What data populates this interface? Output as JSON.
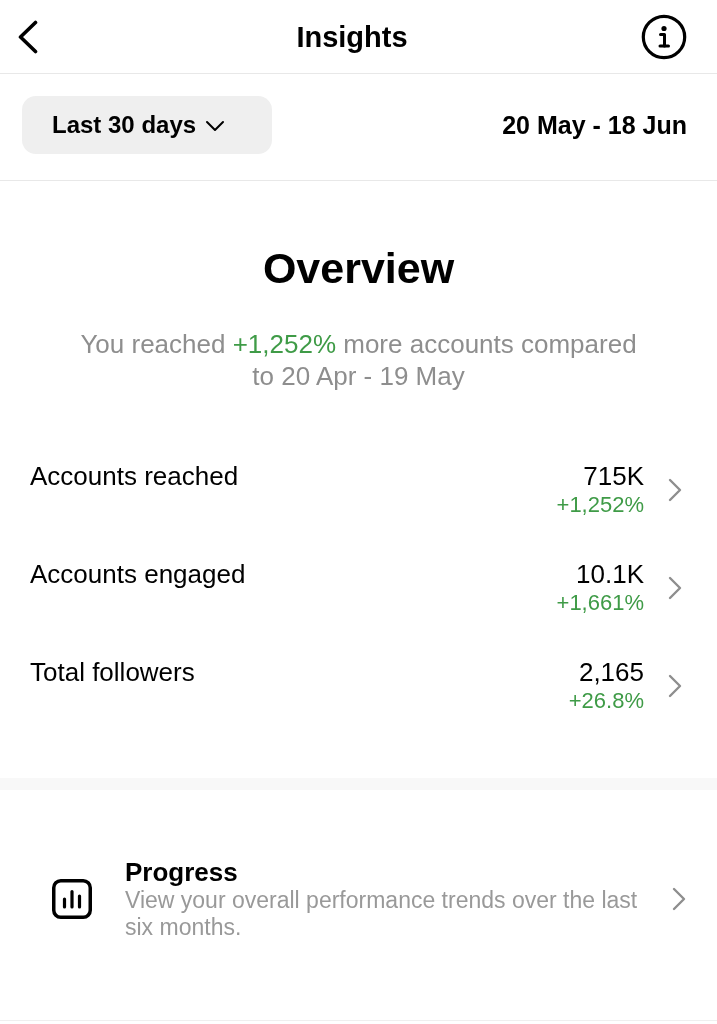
{
  "header": {
    "title": "Insights"
  },
  "filter": {
    "period": "Last 30 days",
    "date_range": "20 May - 18 Jun"
  },
  "overview": {
    "title": "Overview",
    "summary": {
      "before": "You reached ",
      "highlight": "+1,252%",
      "after": " more accounts compared to 20 Apr - 19 May"
    }
  },
  "metrics": [
    {
      "label": "Accounts reached",
      "value": "715K",
      "change": "+1,252%"
    },
    {
      "label": "Accounts engaged",
      "value": "10.1K",
      "change": "+1,661%"
    },
    {
      "label": "Total followers",
      "value": "2,165",
      "change": "+26.8%"
    }
  ],
  "links": [
    {
      "title": "Progress",
      "description": "View your overall performance trends over the last six months."
    }
  ]
}
